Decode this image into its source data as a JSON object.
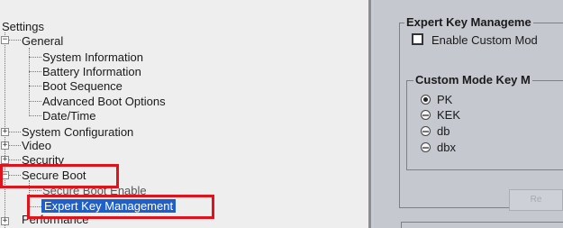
{
  "tree": {
    "root": "Settings",
    "general": {
      "label": "General",
      "expander": "−",
      "children": [
        "System Information",
        "Battery Information",
        "Boot Sequence",
        "Advanced Boot Options",
        "Date/Time"
      ]
    },
    "system_configuration": {
      "label": "System Configuration",
      "expander": "+"
    },
    "video": {
      "label": "Video",
      "expander": "+"
    },
    "security": {
      "label": "Security",
      "expander": "+"
    },
    "secure_boot": {
      "label": "Secure Boot",
      "expander": "−",
      "children": [
        "Secure Boot Enable",
        "Expert Key Management"
      ],
      "selected": "Expert Key Management"
    },
    "performance": {
      "label": "Performance",
      "expander": "+"
    }
  },
  "right": {
    "expert_group_title": "Expert Key Manageme",
    "enable_custom_mode_label": "Enable Custom Mod",
    "enable_custom_mode_checked": false,
    "custom_mode_group_title": "Custom Mode Key M",
    "key_options": [
      {
        "label": "PK",
        "selected": true
      },
      {
        "label": "KEK",
        "selected": false
      },
      {
        "label": "db",
        "selected": false
      },
      {
        "label": "dbx",
        "selected": false
      }
    ],
    "button_label": "Re"
  },
  "colors": {
    "highlight_box": "#e0121c",
    "selection_bg": "#1e5fc9",
    "tree_bg": "#eeeeef",
    "panel_bg": "#c5c8cf"
  }
}
